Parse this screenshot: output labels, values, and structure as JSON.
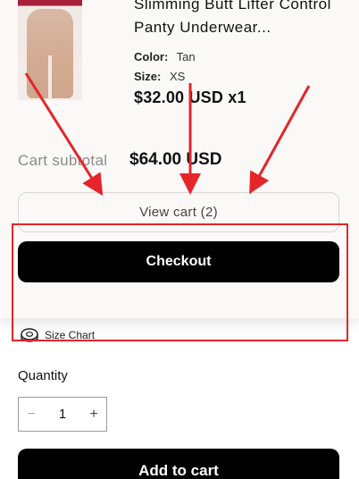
{
  "cart_drawer": {
    "product": {
      "title": "Slimming Butt Lifter Control Panty Underwear...",
      "color_label": "Color:",
      "color_value": "Tan",
      "size_label": "Size:",
      "size_value": "XS",
      "price_line": "$32.00 USD x1"
    },
    "subtotal_label": "Cart subtotal",
    "subtotal_value": "$64.00 USD",
    "view_cart_label": "View cart (2)",
    "checkout_label": "Checkout"
  },
  "product_page": {
    "size_chart_label": "Size Chart",
    "quantity_label": "Quantity",
    "quantity_value": "1",
    "minus_symbol": "−",
    "plus_symbol": "+",
    "add_to_cart_label": "Add to cart"
  },
  "colors": {
    "annotation": "#e5252a",
    "primary_button": "#000000",
    "drawer_background": "#fbf9f8"
  }
}
